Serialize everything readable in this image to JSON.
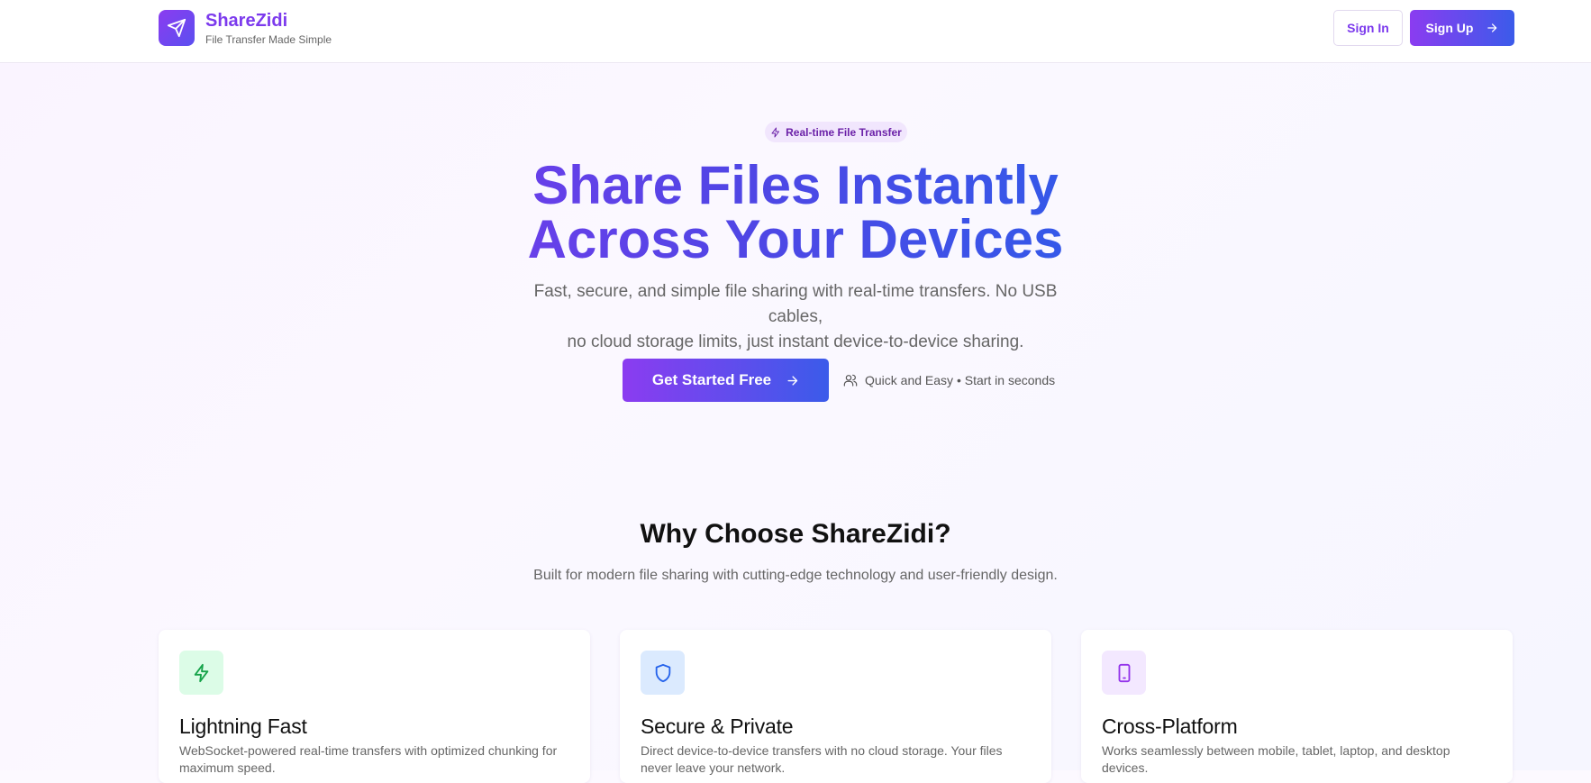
{
  "header": {
    "brand_name": "ShareZidi",
    "brand_tagline": "File Transfer Made Simple",
    "sign_in_label": "Sign In",
    "sign_up_label": "Sign Up"
  },
  "hero": {
    "badge": "Real-time File Transfer",
    "title_line1": "Share Files Instantly",
    "title_line2": "Across Your Devices",
    "subtitle_line1": "Fast, secure, and simple file sharing with real-time transfers. No USB cables,",
    "subtitle_line2": "no cloud storage limits, just instant device-to-device sharing.",
    "cta_label": "Get Started Free",
    "cta_note": "Quick and Easy • Start in seconds"
  },
  "why": {
    "title": "Why Choose ShareZidi?",
    "subtitle": "Built for modern file sharing with cutting-edge technology and user-friendly design."
  },
  "features": [
    {
      "title": "Lightning Fast",
      "description": "WebSocket-powered real-time transfers with optimized chunking for maximum speed.",
      "icon": "zap-icon",
      "icon_bg": "#dcfce7",
      "icon_color": "#16a34a"
    },
    {
      "title": "Secure & Private",
      "description": "Direct device-to-device transfers with no cloud storage. Your files never leave your network.",
      "icon": "shield-icon",
      "icon_bg": "#dbeafe",
      "icon_color": "#2563eb"
    },
    {
      "title": "Cross-Platform",
      "description": "Works seamlessly between mobile, tablet, laptop, and desktop devices.",
      "icon": "tablet-icon",
      "icon_bg": "#f3e8ff",
      "icon_color": "#9333ea"
    }
  ],
  "colors": {
    "brand_purple": "#7c3aed",
    "brand_blue": "#2563eb"
  }
}
